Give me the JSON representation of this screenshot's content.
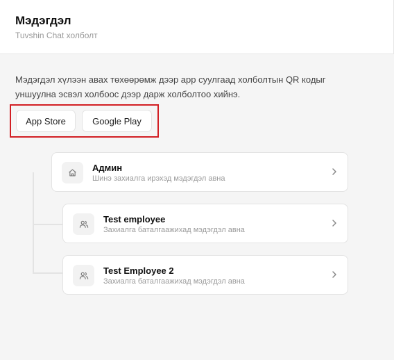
{
  "header": {
    "title": "Мэдэгдэл",
    "subtitle": "Tuvshin Chat холболт"
  },
  "description": "Мэдэгдэл хүлээн авах төхөөрөмж дээр app суулгаад холболтын QR кодыг уншуулна эсвэл холбоос дээр дарж холболтоо хийнэ.",
  "store_buttons": {
    "app_store": "App Store",
    "google_play": "Google Play"
  },
  "highlight_color": "#d21f24",
  "recipients": [
    {
      "name": "Админ",
      "subtitle": "Шинэ захиалга ирэхэд мэдэгдэл авна",
      "icon": "home-icon"
    },
    {
      "name": "Test employee",
      "subtitle": "Захиалга баталгаажихад мэдэгдэл авна",
      "icon": "users-icon"
    },
    {
      "name": "Test Employee 2",
      "subtitle": "Захиалга баталгаажихад мэдэгдэл авна",
      "icon": "users-icon"
    }
  ]
}
